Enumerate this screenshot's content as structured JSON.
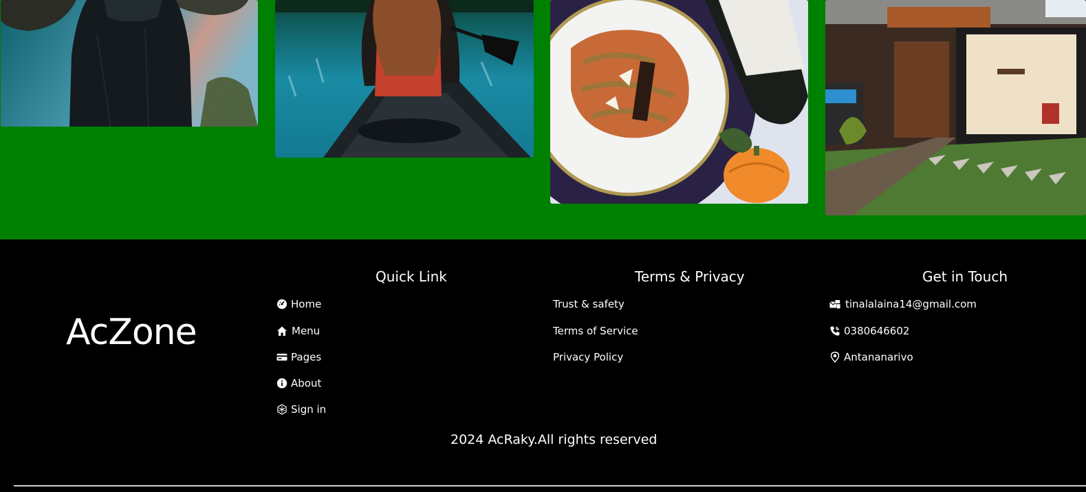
{
  "footer": {
    "brand": "AcZone",
    "quick_link": {
      "title": "Quick Link",
      "items": [
        {
          "label": "Home",
          "icon": "dashboard-icon"
        },
        {
          "label": "Menu",
          "icon": "house-icon"
        },
        {
          "label": "Pages",
          "icon": "card-icon"
        },
        {
          "label": "About",
          "icon": "info-icon"
        },
        {
          "label": "Sign in",
          "icon": "signin-icon"
        }
      ]
    },
    "terms": {
      "title": "Terms & Privacy",
      "items": [
        {
          "label": "Trust & safety"
        },
        {
          "label": "Terms of Service"
        },
        {
          "label": "Privacy Policy"
        }
      ]
    },
    "contact": {
      "title": "Get in Touch",
      "items": [
        {
          "label": "tinalalaina14@gmail.com",
          "icon": "mail-icon"
        },
        {
          "label": "0380646602",
          "icon": "phone-icon"
        },
        {
          "label": "Antananarivo",
          "icon": "location-icon"
        }
      ]
    },
    "copyright": "2024 AcRaky.All rights reserved"
  },
  "colors": {
    "gallery_bg": "#008000",
    "footer_bg": "#000000",
    "text": "#ffffff"
  }
}
